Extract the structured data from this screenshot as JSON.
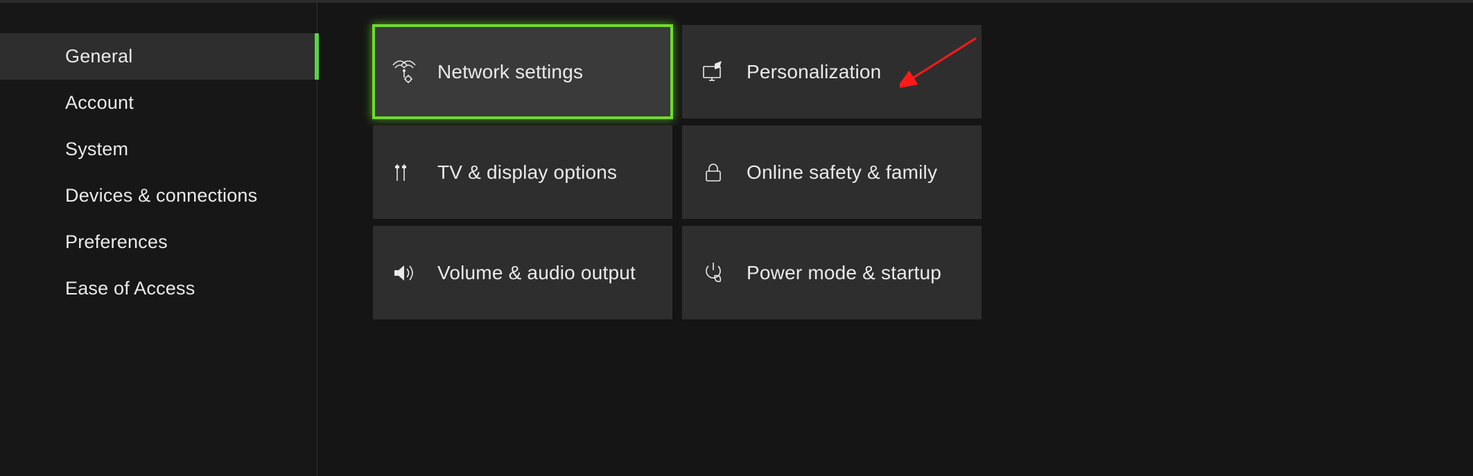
{
  "sidebar": {
    "items": [
      {
        "label": "General",
        "selected": true
      },
      {
        "label": "Account",
        "selected": false
      },
      {
        "label": "System",
        "selected": false
      },
      {
        "label": "Devices & connections",
        "selected": false
      },
      {
        "label": "Preferences",
        "selected": false
      },
      {
        "label": "Ease of Access",
        "selected": false
      }
    ]
  },
  "tiles": [
    {
      "icon": "network",
      "label": "Network settings",
      "focused": true
    },
    {
      "icon": "personal",
      "label": "Personalization",
      "focused": false
    },
    {
      "icon": "display",
      "label": "TV & display options",
      "focused": false
    },
    {
      "icon": "lock",
      "label": "Online safety & family",
      "focused": false
    },
    {
      "icon": "audio",
      "label": "Volume & audio output",
      "focused": false
    },
    {
      "icon": "power",
      "label": "Power mode & startup",
      "focused": false
    }
  ],
  "annotation": {
    "arrow_color": "#ff1a1a"
  },
  "colors": {
    "accent": "#6fdb2e",
    "tile_bg": "#2e2e2e",
    "sidebar_sel": "#2e2e2e"
  }
}
